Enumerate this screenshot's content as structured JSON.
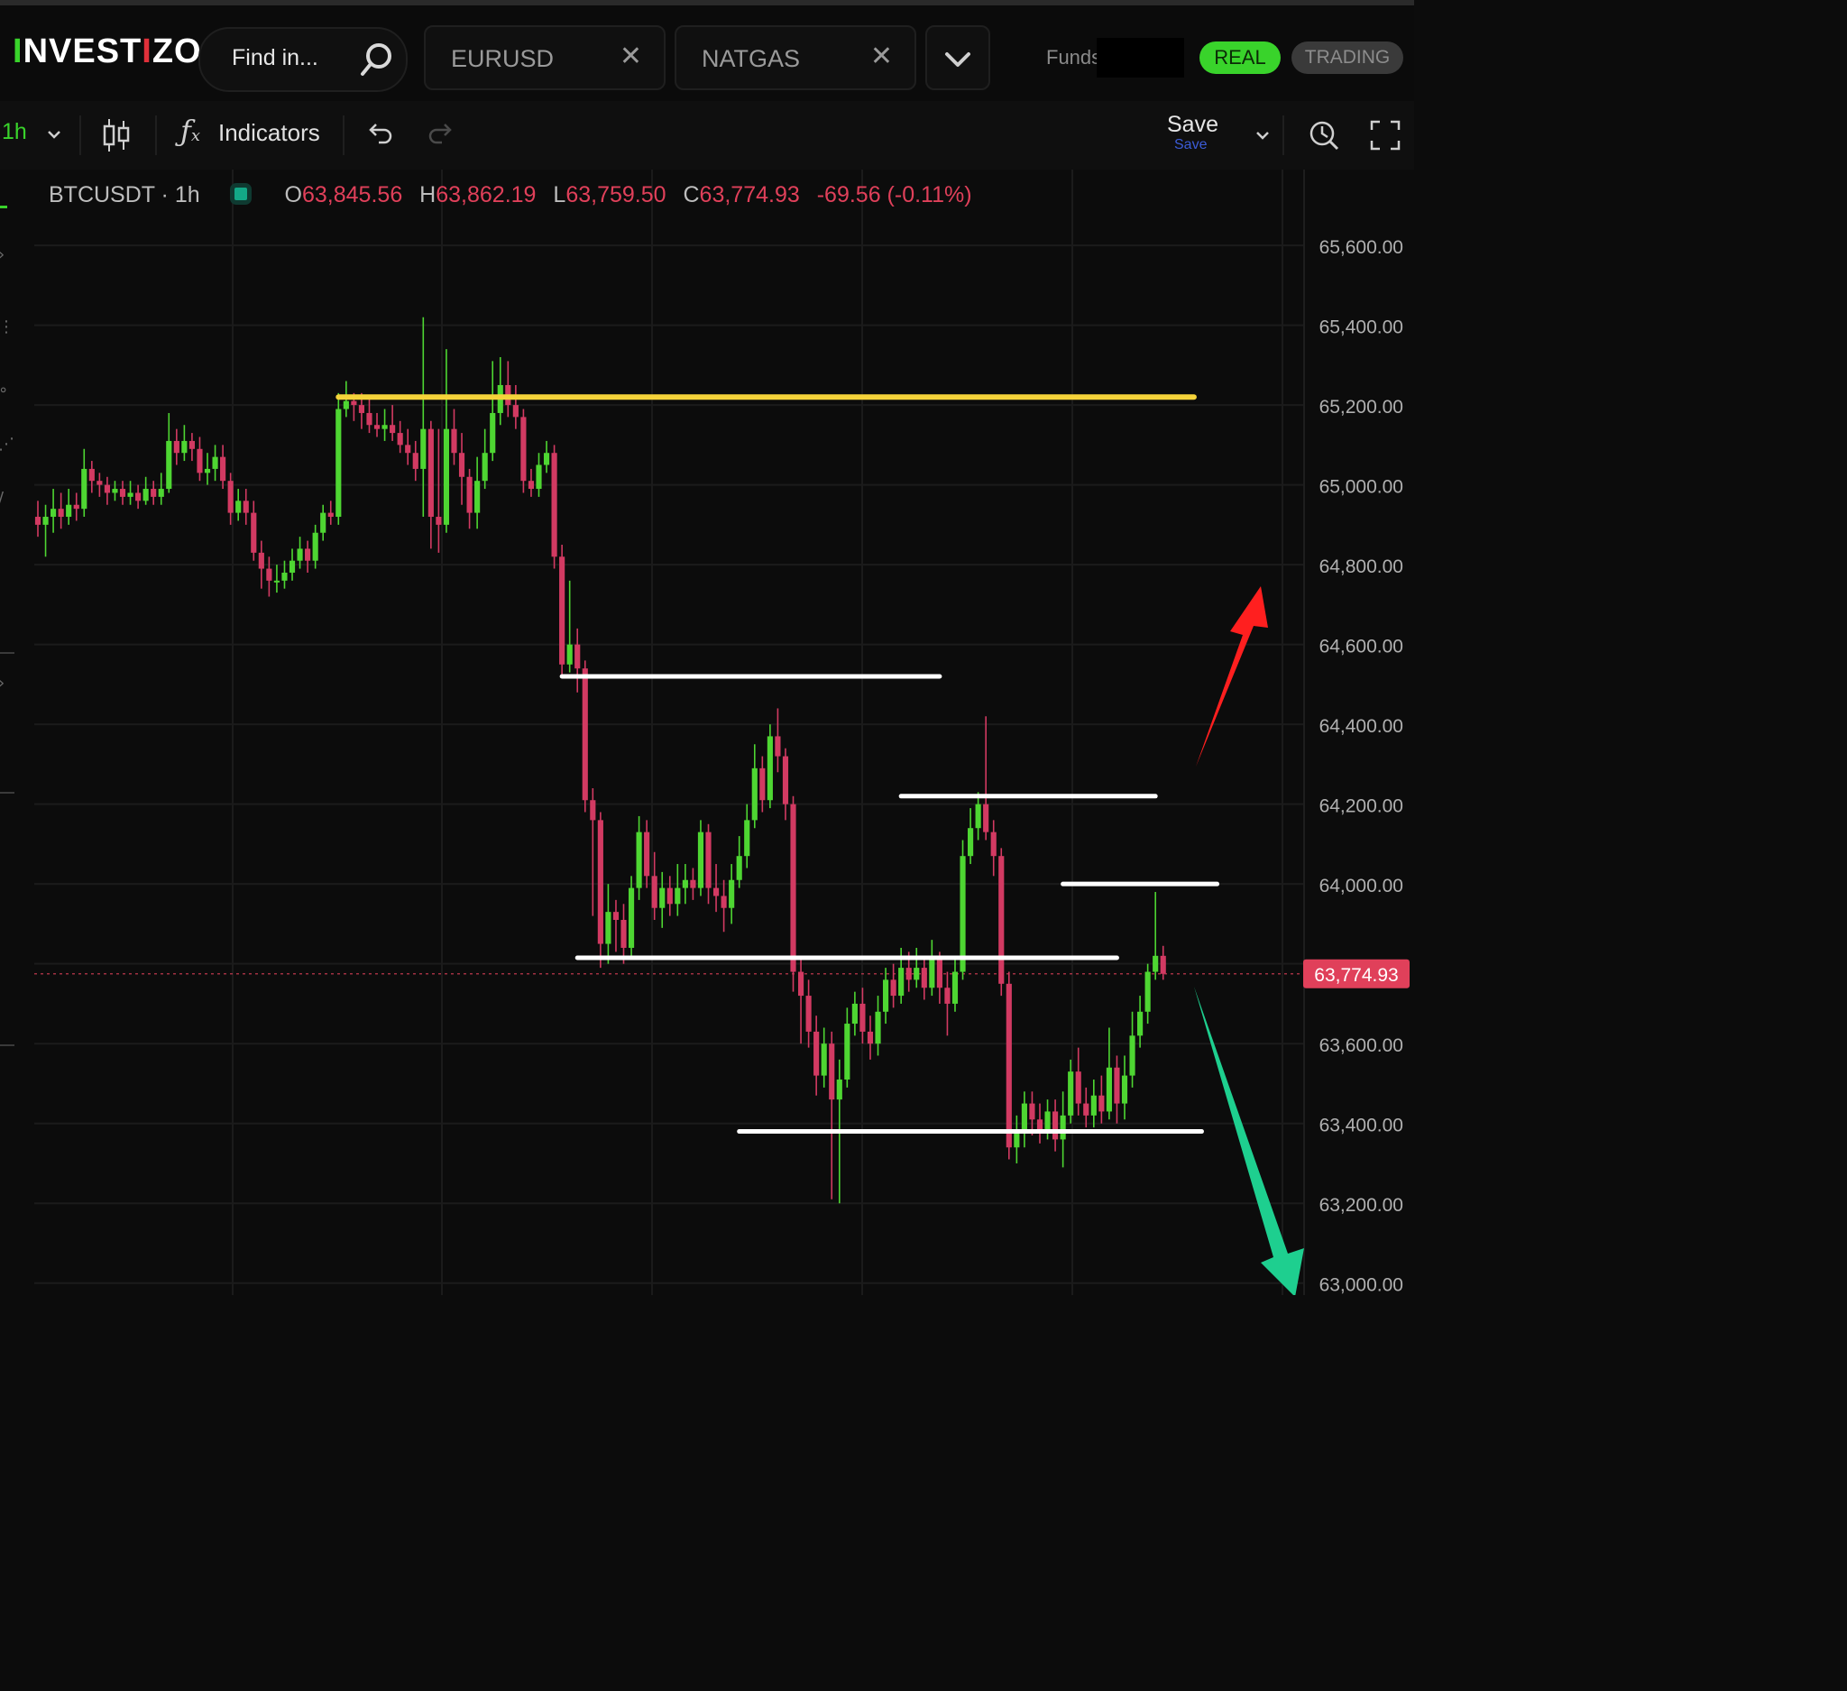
{
  "app": {
    "logo_text": "INVESTIZO",
    "search_placeholder": "Find in...",
    "tabs": [
      {
        "label": "EURUSD"
      },
      {
        "label": "NATGAS"
      }
    ],
    "funds_label": "Funds",
    "mode_real": "REAL",
    "mode_trading": "TRADING"
  },
  "toolbar": {
    "interval": "1h",
    "indicators_label": "Indicators",
    "save_label": "Save",
    "save_sublabel": "Save"
  },
  "legend": {
    "symbol": "BTCUSDT · 1h",
    "o_key": "O",
    "o_val": "63,845.56",
    "h_key": "H",
    "h_val": "63,862.19",
    "l_key": "L",
    "l_val": "63,759.50",
    "c_key": "C",
    "c_val": "63,774.93",
    "change": "-69.56 (-0.11%)"
  },
  "colors": {
    "bull": "#4ed632",
    "bear": "#d23a62",
    "accent_green": "#39d32b",
    "yellow_line": "#f5d33a",
    "price_tag": "#e0405a",
    "arrow_up": "#ff1f1f",
    "arrow_down": "#1ecf8f"
  },
  "chart_data": {
    "type": "candlestick",
    "symbol": "BTCUSDT",
    "interval": "1h",
    "y_ticks": [
      65600,
      65400,
      65200,
      65000,
      64800,
      64600,
      64400,
      64200,
      64000,
      63800,
      63600,
      63400,
      63200,
      63000
    ],
    "y_tick_labels": [
      "65,600.00",
      "65,400.00",
      "65,200.00",
      "65,000.00",
      "64,800.00",
      "64,600.00",
      "64,400.00",
      "64,200.00",
      "64,000.00",
      "",
      "63,600.00",
      "63,400.00",
      "63,200.00",
      "63,000.00"
    ],
    "ylim": [
      62970,
      65790
    ],
    "current_price": 63774.93,
    "current_price_label": "63,774.93",
    "candles": [
      [
        64920,
        64900,
        64960,
        64870
      ],
      [
        64900,
        64920,
        64950,
        64820
      ],
      [
        64920,
        64940,
        64990,
        64880
      ],
      [
        64940,
        64920,
        64980,
        64890
      ],
      [
        64920,
        64950,
        64990,
        64900
      ],
      [
        64950,
        64940,
        64980,
        64910
      ],
      [
        64940,
        65040,
        65090,
        64920
      ],
      [
        65040,
        65010,
        65060,
        64980
      ],
      [
        65010,
        65000,
        65030,
        64970
      ],
      [
        65000,
        64980,
        65020,
        64950
      ],
      [
        64980,
        64990,
        65010,
        64960
      ],
      [
        64990,
        64970,
        65010,
        64950
      ],
      [
        64970,
        64980,
        65010,
        64950
      ],
      [
        64980,
        64960,
        65000,
        64940
      ],
      [
        64960,
        64990,
        65020,
        64950
      ],
      [
        64990,
        64970,
        65010,
        64950
      ],
      [
        64970,
        64990,
        65030,
        64950
      ],
      [
        64990,
        65110,
        65180,
        64980
      ],
      [
        65110,
        65080,
        65140,
        65050
      ],
      [
        65080,
        65110,
        65150,
        65060
      ],
      [
        65110,
        65090,
        65130,
        65060
      ],
      [
        65090,
        65030,
        65120,
        65010
      ],
      [
        65030,
        65040,
        65080,
        65000
      ],
      [
        65040,
        65070,
        65100,
        65010
      ],
      [
        65070,
        65010,
        65100,
        64990
      ],
      [
        65010,
        64930,
        65030,
        64900
      ],
      [
        64930,
        64960,
        64990,
        64910
      ],
      [
        64960,
        64930,
        64990,
        64900
      ],
      [
        64930,
        64830,
        64960,
        64810
      ],
      [
        64830,
        64790,
        64860,
        64740
      ],
      [
        64790,
        64760,
        64820,
        64720
      ],
      [
        64760,
        64760,
        64800,
        64730
      ],
      [
        64760,
        64780,
        64810,
        64740
      ],
      [
        64780,
        64810,
        64840,
        64760
      ],
      [
        64810,
        64840,
        64870,
        64790
      ],
      [
        64840,
        64810,
        64860,
        64780
      ],
      [
        64810,
        64880,
        64900,
        64790
      ],
      [
        64880,
        64930,
        64950,
        64860
      ],
      [
        64930,
        64920,
        64960,
        64900
      ],
      [
        64920,
        65190,
        65230,
        64900
      ],
      [
        65190,
        65210,
        65260,
        65170
      ],
      [
        65210,
        65200,
        65230,
        65160
      ],
      [
        65200,
        65180,
        65230,
        65140
      ],
      [
        65180,
        65150,
        65220,
        65130
      ],
      [
        65150,
        65140,
        65180,
        65120
      ],
      [
        65140,
        65150,
        65190,
        65110
      ],
      [
        65150,
        65130,
        65200,
        65110
      ],
      [
        65130,
        65100,
        65160,
        65080
      ],
      [
        65100,
        65080,
        65140,
        65050
      ],
      [
        65080,
        65040,
        65110,
        65010
      ],
      [
        65040,
        65140,
        65420,
        64920
      ],
      [
        65140,
        64920,
        65160,
        64840
      ],
      [
        64920,
        64900,
        65140,
        64830
      ],
      [
        64900,
        65140,
        65340,
        64880
      ],
      [
        65140,
        65080,
        65190,
        65050
      ],
      [
        65080,
        65020,
        65130,
        64950
      ],
      [
        65020,
        64930,
        65040,
        64890
      ],
      [
        64930,
        65010,
        65070,
        64890
      ],
      [
        65010,
        65080,
        65140,
        64990
      ],
      [
        65080,
        65180,
        65310,
        65060
      ],
      [
        65180,
        65250,
        65320,
        65150
      ],
      [
        65250,
        65200,
        65310,
        65170
      ],
      [
        65200,
        65170,
        65250,
        65140
      ],
      [
        65170,
        65010,
        65190,
        64980
      ],
      [
        65010,
        64990,
        65040,
        64970
      ],
      [
        64990,
        65050,
        65080,
        64970
      ],
      [
        65050,
        65080,
        65110,
        65030
      ],
      [
        65080,
        64820,
        65100,
        64790
      ],
      [
        64820,
        64550,
        64850,
        64520
      ],
      [
        64550,
        64600,
        64760,
        64530
      ],
      [
        64600,
        64540,
        64640,
        64480
      ],
      [
        64540,
        64210,
        64560,
        64180
      ],
      [
        64210,
        64160,
        64240,
        63920
      ],
      [
        64160,
        63850,
        64180,
        63790
      ],
      [
        63850,
        63930,
        64000,
        63800
      ],
      [
        63930,
        63910,
        63960,
        63830
      ],
      [
        63910,
        63840,
        63950,
        63800
      ],
      [
        63840,
        63990,
        64020,
        63820
      ],
      [
        63990,
        64130,
        64170,
        63960
      ],
      [
        64130,
        64020,
        64160,
        63990
      ],
      [
        64020,
        63940,
        64080,
        63910
      ],
      [
        63940,
        63990,
        64030,
        63890
      ],
      [
        63990,
        63950,
        64020,
        63920
      ],
      [
        63950,
        63990,
        64050,
        63920
      ],
      [
        63990,
        64010,
        64050,
        63950
      ],
      [
        64010,
        63990,
        64040,
        63960
      ],
      [
        63990,
        64130,
        64160,
        63970
      ],
      [
        64130,
        63990,
        64150,
        63950
      ],
      [
        63990,
        63970,
        64050,
        63930
      ],
      [
        63970,
        63940,
        64010,
        63880
      ],
      [
        63940,
        64010,
        64050,
        63900
      ],
      [
        64010,
        64070,
        64120,
        63990
      ],
      [
        64070,
        64160,
        64200,
        64040
      ],
      [
        64160,
        64290,
        64350,
        64140
      ],
      [
        64290,
        64210,
        64320,
        64180
      ],
      [
        64210,
        64370,
        64400,
        64190
      ],
      [
        64370,
        64320,
        64440,
        64280
      ],
      [
        64320,
        64200,
        64340,
        64160
      ],
      [
        64200,
        63780,
        64220,
        63730
      ],
      [
        63780,
        63720,
        63820,
        63600
      ],
      [
        63720,
        63630,
        63760,
        63590
      ],
      [
        63630,
        63520,
        63670,
        63470
      ],
      [
        63520,
        63600,
        63640,
        63490
      ],
      [
        63600,
        63460,
        63630,
        63210
      ],
      [
        63460,
        63510,
        63560,
        63200
      ],
      [
        63510,
        63650,
        63690,
        63490
      ],
      [
        63650,
        63700,
        63730,
        63620
      ],
      [
        63700,
        63630,
        63740,
        63600
      ],
      [
        63630,
        63600,
        63670,
        63560
      ],
      [
        63600,
        63680,
        63720,
        63570
      ],
      [
        63680,
        63760,
        63790,
        63650
      ],
      [
        63760,
        63720,
        63800,
        63690
      ],
      [
        63720,
        63790,
        63840,
        63700
      ],
      [
        63790,
        63760,
        63830,
        63730
      ],
      [
        63760,
        63790,
        63840,
        63740
      ],
      [
        63790,
        63740,
        63820,
        63710
      ],
      [
        63740,
        63810,
        63860,
        63720
      ],
      [
        63810,
        63740,
        63830,
        63700
      ],
      [
        63740,
        63700,
        63780,
        63620
      ],
      [
        63700,
        63780,
        63810,
        63680
      ],
      [
        63780,
        64070,
        64110,
        63760
      ],
      [
        64070,
        64140,
        64190,
        64050
      ],
      [
        64140,
        64200,
        64230,
        64110
      ],
      [
        64200,
        64130,
        64420,
        64110
      ],
      [
        64130,
        64070,
        64160,
        64020
      ],
      [
        64070,
        63750,
        64090,
        63720
      ],
      [
        63750,
        63340,
        63780,
        63310
      ],
      [
        63340,
        63380,
        63420,
        63300
      ],
      [
        63380,
        63450,
        63480,
        63340
      ],
      [
        63450,
        63410,
        63480,
        63370
      ],
      [
        63410,
        63380,
        63450,
        63350
      ],
      [
        63380,
        63430,
        63460,
        63360
      ],
      [
        63430,
        63360,
        63460,
        63330
      ],
      [
        63360,
        63420,
        63480,
        63290
      ],
      [
        63420,
        63530,
        63560,
        63400
      ],
      [
        63530,
        63450,
        63590,
        63420
      ],
      [
        63450,
        63420,
        63490,
        63390
      ],
      [
        63420,
        63470,
        63510,
        63390
      ],
      [
        63470,
        63430,
        63520,
        63400
      ],
      [
        63430,
        63540,
        63640,
        63410
      ],
      [
        63540,
        63450,
        63570,
        63400
      ],
      [
        63450,
        63520,
        63570,
        63410
      ],
      [
        63520,
        63620,
        63680,
        63490
      ],
      [
        63620,
        63680,
        63720,
        63590
      ],
      [
        63680,
        63780,
        63800,
        63650
      ],
      [
        63780,
        63820,
        63980,
        63760
      ],
      [
        63820,
        63775,
        63845,
        63760
      ]
    ],
    "annotations": [
      {
        "type": "hline",
        "color": "#f5d33a",
        "price": 65220,
        "x_from_candle": 39,
        "x_to_candle": 150
      },
      {
        "type": "hline",
        "color": "#ffffff",
        "price": 64520,
        "x_from_candle": 68,
        "x_to_candle": 117
      },
      {
        "type": "hline",
        "color": "#ffffff",
        "price": 64220,
        "x_from_candle": 112,
        "x_to_candle": 145
      },
      {
        "type": "hline",
        "color": "#ffffff",
        "price": 64000,
        "x_from_candle": 133,
        "x_to_candle": 153
      },
      {
        "type": "hline",
        "color": "#ffffff",
        "price": 63815,
        "x_from_candle": 70,
        "x_to_candle": 140
      },
      {
        "type": "hline",
        "color": "#ffffff",
        "price": 63380,
        "x_from_candle": 91,
        "x_to_candle": 151
      },
      {
        "type": "arrow",
        "direction": "up",
        "color": "#ff1f1f"
      },
      {
        "type": "arrow",
        "direction": "down",
        "color": "#1ecf8f"
      }
    ]
  }
}
